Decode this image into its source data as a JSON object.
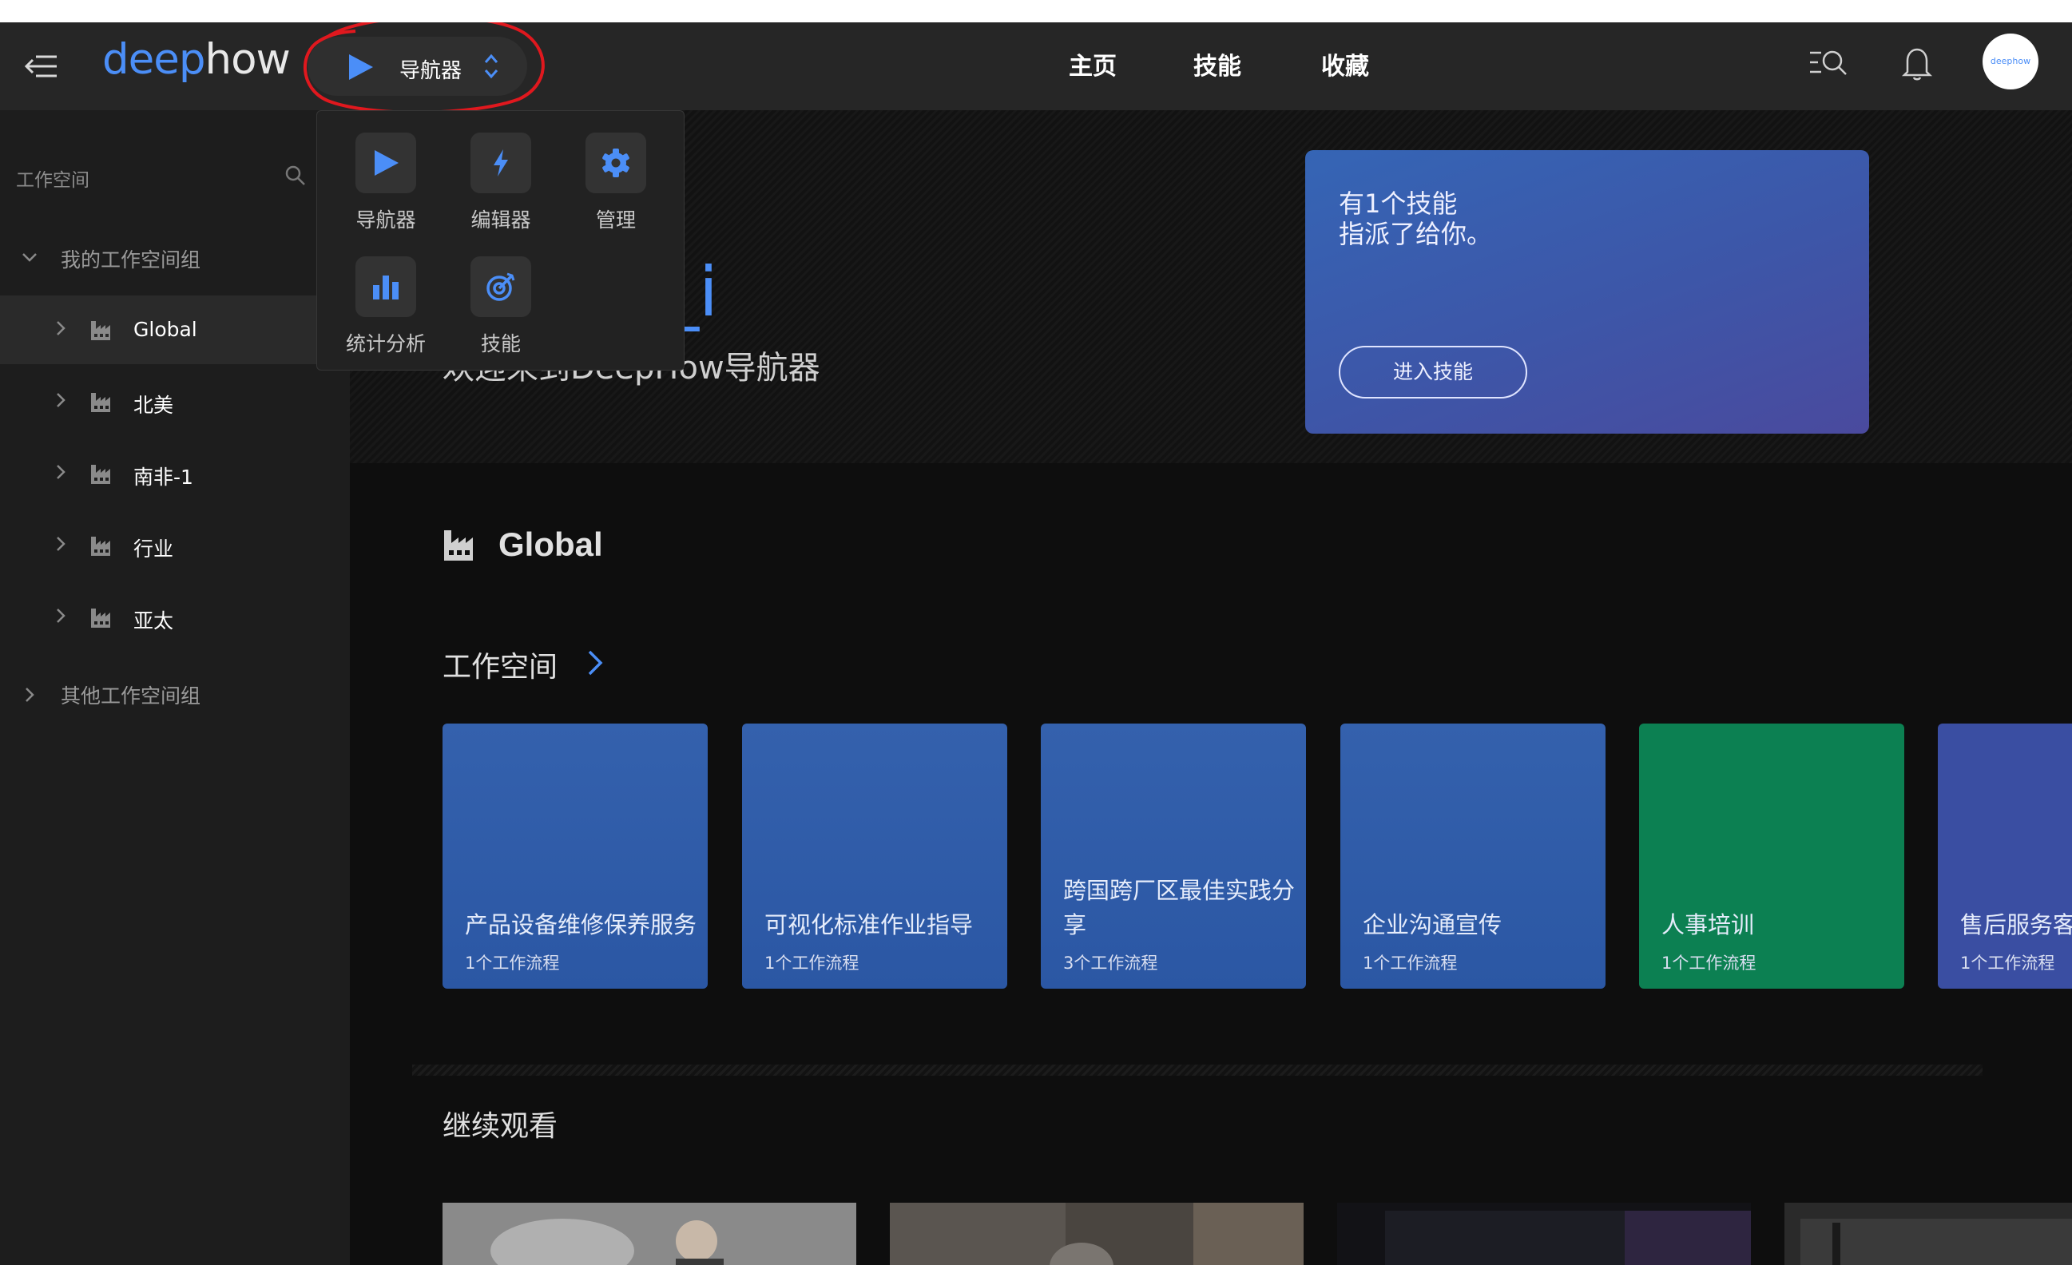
{
  "app": {
    "logo_prefix": "deep",
    "logo_suffix": "how",
    "switcher_label": "导航器",
    "avatar_text": "deephow"
  },
  "nav": {
    "tabs": [
      {
        "label": "主页"
      },
      {
        "label": "技能"
      },
      {
        "label": "收藏"
      }
    ]
  },
  "dropdown": {
    "items": [
      {
        "label": "导航器",
        "icon": "play-icon"
      },
      {
        "label": "编辑器",
        "icon": "bolt-icon"
      },
      {
        "label": "管理",
        "icon": "gear-icon"
      },
      {
        "label": "统计分析",
        "icon": "bar-chart-icon"
      },
      {
        "label": "技能",
        "icon": "target-icon"
      }
    ]
  },
  "sidebar": {
    "search_label": "工作空间",
    "my_group": "我的工作空间组",
    "items": [
      {
        "label": "Global"
      },
      {
        "label": "北美"
      },
      {
        "label": "南非-1"
      },
      {
        "label": "行业"
      },
      {
        "label": "亚太"
      }
    ],
    "other_group": "其他工作空间组"
  },
  "hero": {
    "name_fragment": "_i",
    "welcome": "欢迎来到DeepHow导航器",
    "skill_line1": "有1个技能",
    "skill_line2": "指派了给你。",
    "skill_button": "进入技能"
  },
  "main": {
    "section_title": "Global",
    "workspaces_title": "工作空间",
    "continue_title": "继续观看",
    "workspaces": [
      {
        "name": "产品设备维修保养服务",
        "count": "1个工作流程"
      },
      {
        "name": "可视化标准作业指导",
        "count": "1个工作流程"
      },
      {
        "name": "跨国跨厂区最佳实践分享",
        "count": "3个工作流程"
      },
      {
        "name": "企业沟通宣传",
        "count": "1个工作流程"
      },
      {
        "name": "人事培训",
        "count": "1个工作流程"
      },
      {
        "name": "售后服务客",
        "count": "1个工作流程"
      }
    ]
  },
  "colors": {
    "accent": "#4b8ef7",
    "card_blue": "#2f5caa",
    "card_green": "#0c8052",
    "card_purple": "#3a4ea2",
    "annotation_red": "#e0181e"
  }
}
